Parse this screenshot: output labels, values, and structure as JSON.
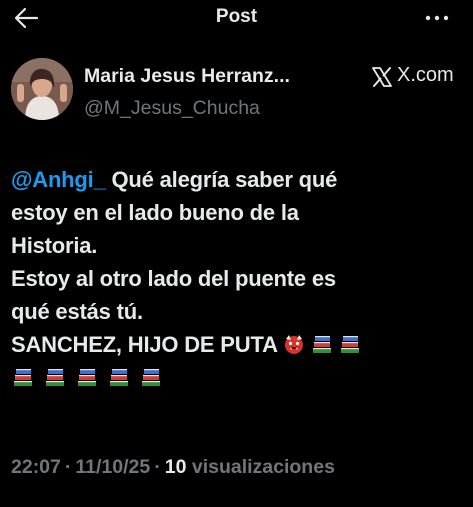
{
  "header": {
    "title": "Post",
    "back_icon": "back-arrow-icon",
    "more_icon": "more-options-icon"
  },
  "author": {
    "display_name": "Maria Jesus Herranz...",
    "handle": "@M_Jesus_Chucha",
    "source": "X.com"
  },
  "tweet": {
    "mention": "@Anhgi_",
    "line1_rest": " Qué alegría saber qué",
    "line2": "estoy en el lado bueno de la",
    "line3": "Historia.",
    "line4": "Estoy al otro lado del puente es",
    "line5": "qué estás tú.",
    "line6": "SANCHEZ, HIJO DE PUTA",
    "emojis": [
      "ogre-face",
      "books",
      "books",
      "books",
      "books",
      "books",
      "books"
    ]
  },
  "meta": {
    "time": "22:07",
    "date": "11/10/25",
    "separator": "·",
    "views_count": "10",
    "views_label": "visualizaciones"
  },
  "colors": {
    "background": "#000000",
    "text": "#e7e9ea",
    "secondary": "#71767b",
    "accent": "#1d9bf0"
  }
}
